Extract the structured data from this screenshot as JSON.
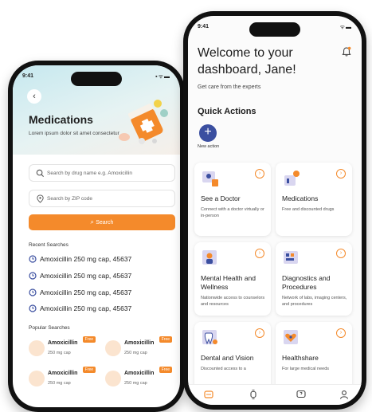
{
  "left_phone": {
    "status_time": "9:41",
    "status_icons": "▪ᯤ▬",
    "back_glyph": "‹",
    "title": "Medications",
    "subtitle": "Lorem ipsum dolor sit amet consectetur",
    "drug_search_placeholder": "Search by drug name e.g. Amoxicillin",
    "zip_placeholder": "Search by ZIP code",
    "search_button": "Search",
    "recent_label": "Recent Searches",
    "recent": [
      "Amoxicillin 250 mg cap, 45637",
      "Amoxicillin 250 mg cap, 45637",
      "Amoxicillin 250 mg cap, 45637",
      "Amoxicillin 250 mg cap, 45637"
    ],
    "popular_label": "Popular Searches",
    "popular": [
      {
        "name": "Amoxicillin",
        "dose": "250 mg cap",
        "badge": "Free"
      },
      {
        "name": "Amoxicillin",
        "dose": "250 mg cap",
        "badge": "Free"
      },
      {
        "name": "Amoxicillin",
        "dose": "250 mg cap",
        "badge": "Free"
      },
      {
        "name": "Amoxicillin",
        "dose": "250 mg cap",
        "badge": "Free"
      }
    ]
  },
  "right_phone": {
    "status_time": "9:41",
    "status_icons": "ᯤ▬",
    "welcome": "Welcome to your dashboard, Jane!",
    "care": "Get care from the experts",
    "quick_actions_title": "Quick Actions",
    "new_action_glyph": "+",
    "new_action_label": "New action",
    "arrow_glyph": "›",
    "cards": [
      {
        "title": "See a Doctor",
        "desc": "Connect with a doctor virtually or in-person"
      },
      {
        "title": "Medications",
        "desc": "Free and discounted drugs"
      },
      {
        "title": "Mental Health and Wellness",
        "desc": "Nationwide access to counselors and resources"
      },
      {
        "title": "Diagnostics and Procedures",
        "desc": "Network of labs, imaging centers, and procedures"
      },
      {
        "title": "Dental and Vision",
        "desc": "Discounted access to a"
      },
      {
        "title": "Healthshare",
        "desc": "For large medical needs"
      }
    ],
    "tabs": [
      "home-tab-icon",
      "watch-tab-icon",
      "help-tab-icon",
      "profile-tab-icon"
    ]
  },
  "colors": {
    "accent": "#f48a2b",
    "primary": "#3b4fa0"
  }
}
